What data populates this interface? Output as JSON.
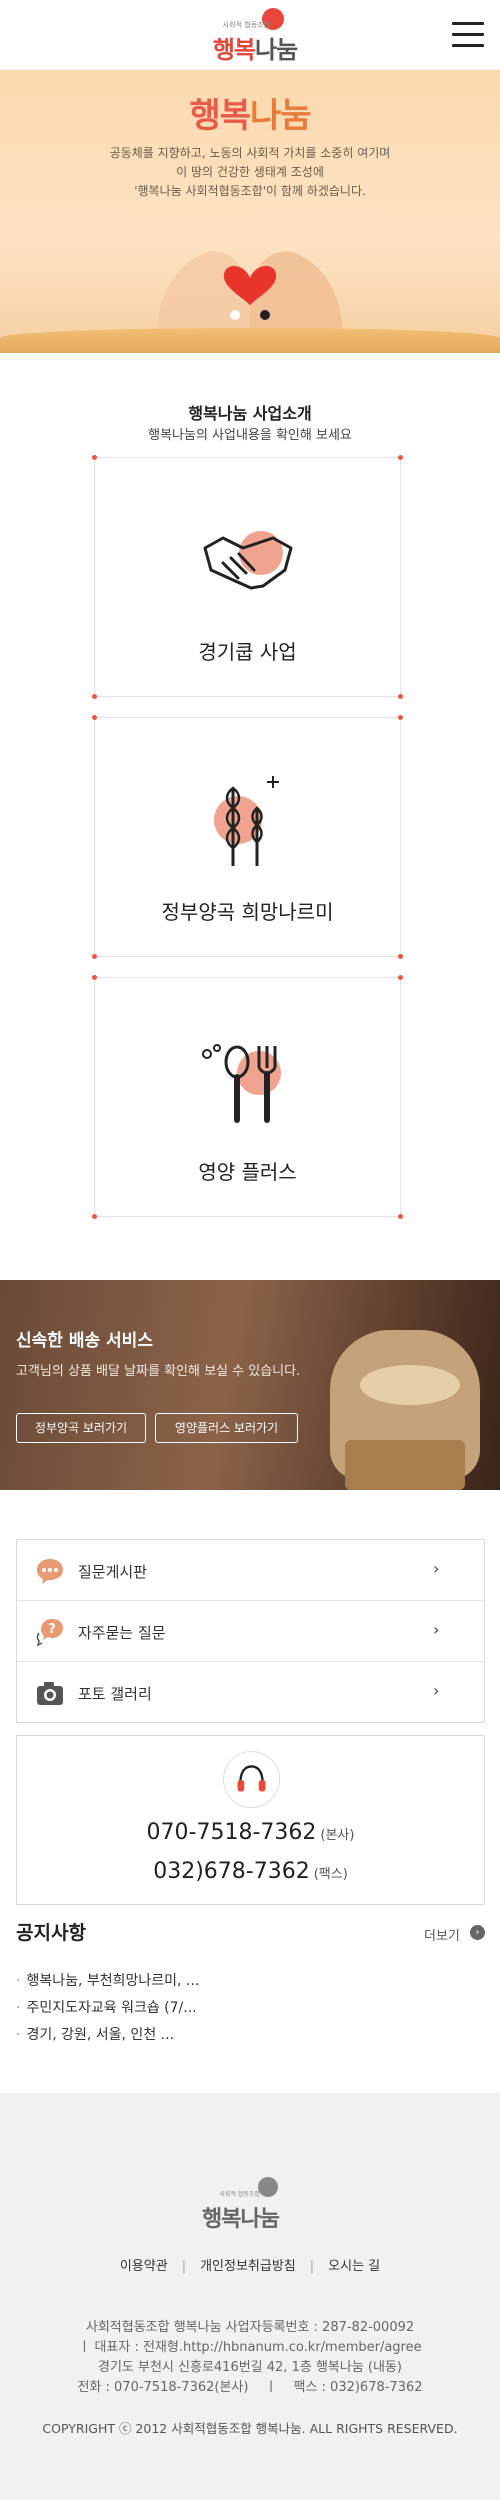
{
  "header": {
    "logo_sub": "사회적 협동조합",
    "logo_part1": "행복",
    "logo_part2": "나눔",
    "menu_icon": "hamburger-menu-icon"
  },
  "hero": {
    "title_part1": "행복",
    "title_part2": "나눔",
    "line1": "공동체를 지향하고, 노동의 사회적 가치를 소중히 여기며",
    "line2": "이 땅의 건강한 생태계 조성에",
    "line3": "'행복나눔 사회적협동조합'이 함께 하겠습니다.",
    "slide_count": 2,
    "active_slide": 2
  },
  "business": {
    "title": "행복나눔 사업소개",
    "subtitle": "행복나눔의 사업내용을 확인해 보세요",
    "cards": [
      {
        "label": "경기쿱 사업",
        "icon": "handshake-icon"
      },
      {
        "label": "정부양곡 희망나르미",
        "icon": "wheat-icon"
      },
      {
        "label": "영양 플러스",
        "icon": "spoon-fork-icon"
      }
    ]
  },
  "delivery": {
    "title": "신속한 배송 서비스",
    "subtitle": "고객님의 상품 배달 날짜를 확인해 보실 수 있습니다.",
    "btn1": "정부양곡 보러가기",
    "btn2": "영양플러스 보러가기"
  },
  "boards": [
    {
      "label": "질문게시판",
      "icon": "speech-bubble-icon",
      "arrow": "›"
    },
    {
      "label": "자주묻는 질문",
      "icon": "question-bubble-icon",
      "arrow": "›"
    },
    {
      "label": "포토 갤러리",
      "icon": "camera-icon",
      "arrow": "›"
    }
  ],
  "contact": {
    "icon": "headset-icon",
    "phone1": "070-7518-7362",
    "phone1_note": "(본사)",
    "phone2": "032)678-7362",
    "phone2_note": "(팩스)"
  },
  "notices": {
    "title": "공지사항",
    "more": "더보기",
    "items": [
      "행복나눔, 부천희망나르미, ...",
      "주민지도자교육 워크숍 (7/...",
      "경기, 강원, 서울, 인천 ..."
    ]
  },
  "footer": {
    "logo_sub": "사회적 협동조합",
    "logo_part1": "행복",
    "logo_part2": "나눔",
    "links": [
      "이용약관",
      "개인정보취급방침",
      "오시는 길"
    ],
    "info1": "사회적협동조합 행복나눔 사업자등록번호 : 287-82-00092",
    "info2": "ㅣ  대표자 : 전재형.http://hbnanum.co.kr/member/agree",
    "info3": "경기도 부천시 신흥로416번길 42, 1층 행복나눔 (내동)",
    "info4": "전화 : 070-7518-7362(본사)    ㅣ    팩스 : 032)678-7362",
    "copyright": "COPYRIGHT ⓒ 2012 사회적협동조합 행복나눔. ALL RIGHTS RESERVED."
  }
}
